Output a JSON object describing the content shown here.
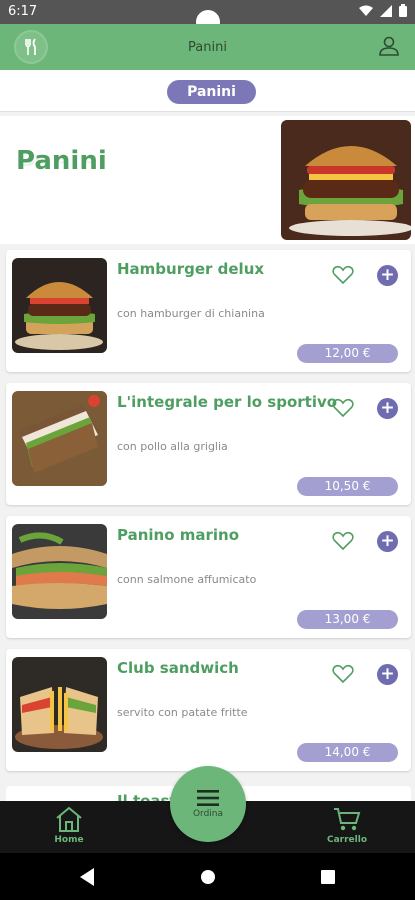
{
  "status_bar": {
    "time": "6:17",
    "icons": [
      "wifi-icon",
      "signal-icon",
      "battery-icon"
    ]
  },
  "app_bar": {
    "title": "Panini",
    "logo_icon": "cutlery-icon",
    "account_icon": "account-icon"
  },
  "category_chip": {
    "label": "Panini"
  },
  "hero": {
    "title": "Panini"
  },
  "products": [
    {
      "name": "Hamburger delux",
      "description": "con hamburger di chianina",
      "price": "12,00 €"
    },
    {
      "name": "L'integrale per lo sportivo",
      "description": "con pollo alla griglia",
      "price": "10,50 €"
    },
    {
      "name": "Panino marino",
      "description": "conn salmone affumicato",
      "price": "13,00 €"
    },
    {
      "name": "Club sandwich",
      "description": "servito con patate fritte",
      "price": "14,00 €"
    }
  ],
  "partial_product": {
    "name": "Il toast..."
  },
  "bottom_nav": {
    "home_label": "Home",
    "order_label": "Ordina",
    "cart_label": "Carrello"
  },
  "colors": {
    "primary_green": "#6db679",
    "title_green": "#4f9e61",
    "accent_purple": "#6f6cb0",
    "price_purple": "#a3a0d1",
    "nav_bg": "#161616"
  }
}
